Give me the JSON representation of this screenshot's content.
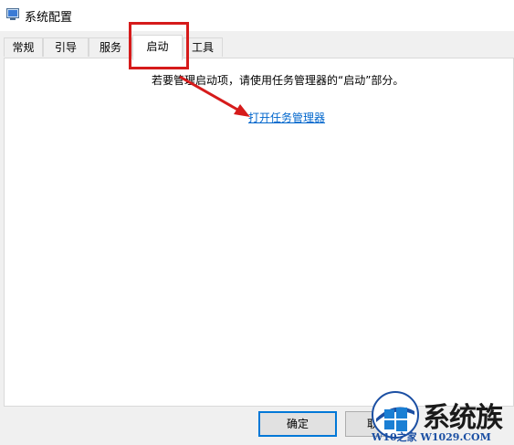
{
  "window": {
    "title": "系统配置"
  },
  "tabs": [
    {
      "label": "常规"
    },
    {
      "label": "引导"
    },
    {
      "label": "服务"
    },
    {
      "label": "启动"
    },
    {
      "label": "工具"
    }
  ],
  "active_tab": "启动",
  "startup": {
    "hint": "若要管理启动项，请使用任务管理器的“启动”部分。",
    "link": "打开任务管理器"
  },
  "buttons": {
    "ok": "确定",
    "cancel": "取"
  },
  "watermark": {
    "brand": "系统族",
    "url": "W10之家 W1029.COM"
  },
  "colors": {
    "highlight": "#d61b1b",
    "link": "#0066cc",
    "focus": "#0078d7"
  }
}
